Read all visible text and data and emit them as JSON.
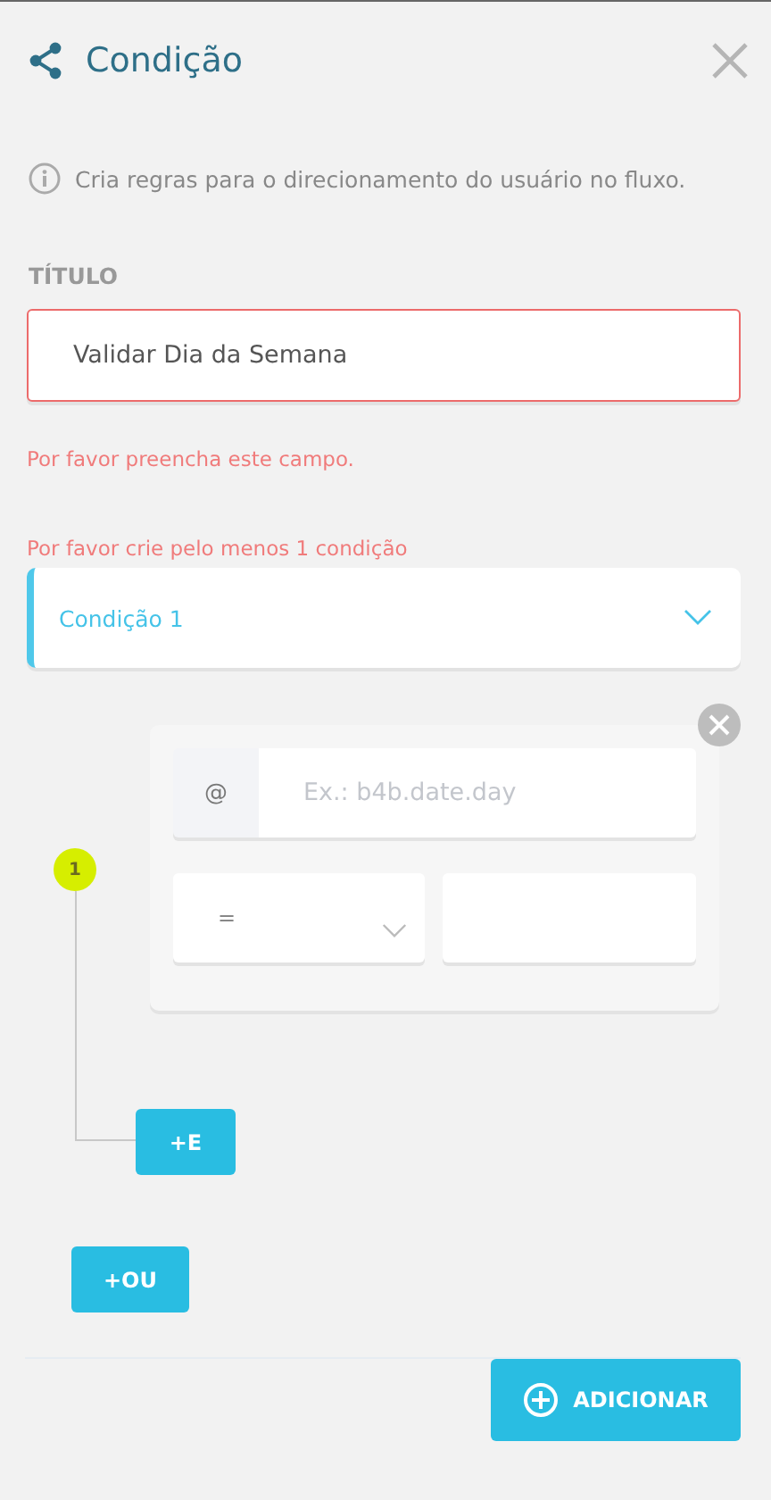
{
  "header": {
    "title": "Condição"
  },
  "info": "Cria regras para o direcionamento do usuário no fluxo.",
  "title_field": {
    "label": "TÍTULO",
    "value": "Validar Dia da Semana",
    "error": "Por favor preencha este campo."
  },
  "conditions_error": "Por favor crie pelo menos 1 condição",
  "conditions": [
    {
      "label": "Condição 1",
      "expanded": true,
      "add_and": "+E",
      "rules": [
        {
          "number": "1",
          "prefix": "@",
          "placeholder": "Ex.: b4b.date.day",
          "operator": "="
        }
      ]
    }
  ],
  "add_or": "+OU",
  "submit": "ADICIONAR"
}
